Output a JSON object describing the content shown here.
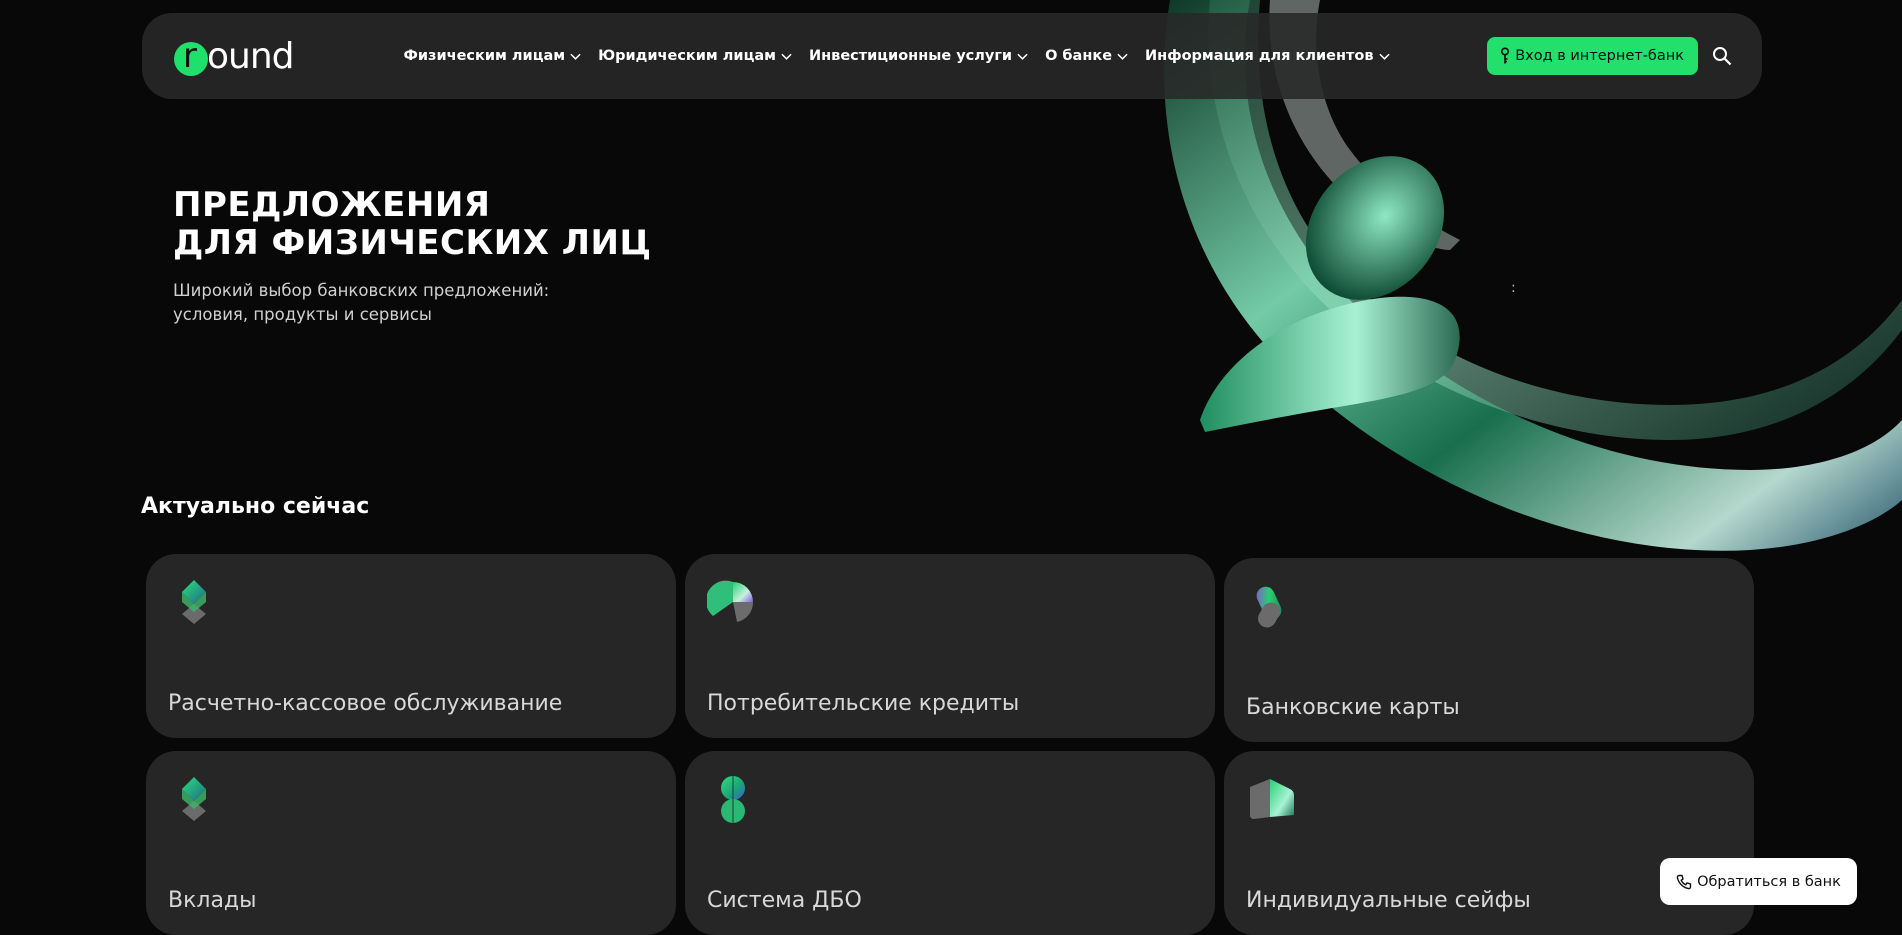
{
  "header": {
    "logo_text": "round",
    "logo_letter": "r",
    "logo_rest": "ound",
    "nav": [
      {
        "label": "Физическим лицам"
      },
      {
        "label": "Юридическим лицам"
      },
      {
        "label": "Инвестиционные услуги"
      },
      {
        "label": "О банке"
      },
      {
        "label": "Информация для клиентов"
      }
    ],
    "login_label": "Вход в интернет-банк"
  },
  "hero": {
    "title_line1": "ПРЕДЛОЖЕНИЯ",
    "title_line2": "ДЛЯ ФИЗИЧЕСКИХ ЛИЦ",
    "subtitle_line1": "Широкий выбор банковских предложений:",
    "subtitle_line2": "условия, продукты и сервисы",
    "mark": ":"
  },
  "section": {
    "title": "Актуально сейчас"
  },
  "cards": [
    {
      "label": "Расчетно-кассовое обслуживание",
      "icon": "diamond-stack-icon"
    },
    {
      "label": "Потребительские кредиты",
      "icon": "pie-icon"
    },
    {
      "label": "Банковские карты",
      "icon": "capsule-icon"
    },
    {
      "label": "Вклады",
      "icon": "diamond-stack-icon"
    },
    {
      "label": "Система ДБО",
      "icon": "figure-eight-icon"
    },
    {
      "label": "Индивидуальные сейфы",
      "icon": "folded-shape-icon"
    }
  ],
  "contact_button": {
    "label": "Обратиться в банк"
  },
  "colors": {
    "accent": "#22e06b",
    "background": "#080808",
    "card": "#262626",
    "header": "#282828"
  }
}
